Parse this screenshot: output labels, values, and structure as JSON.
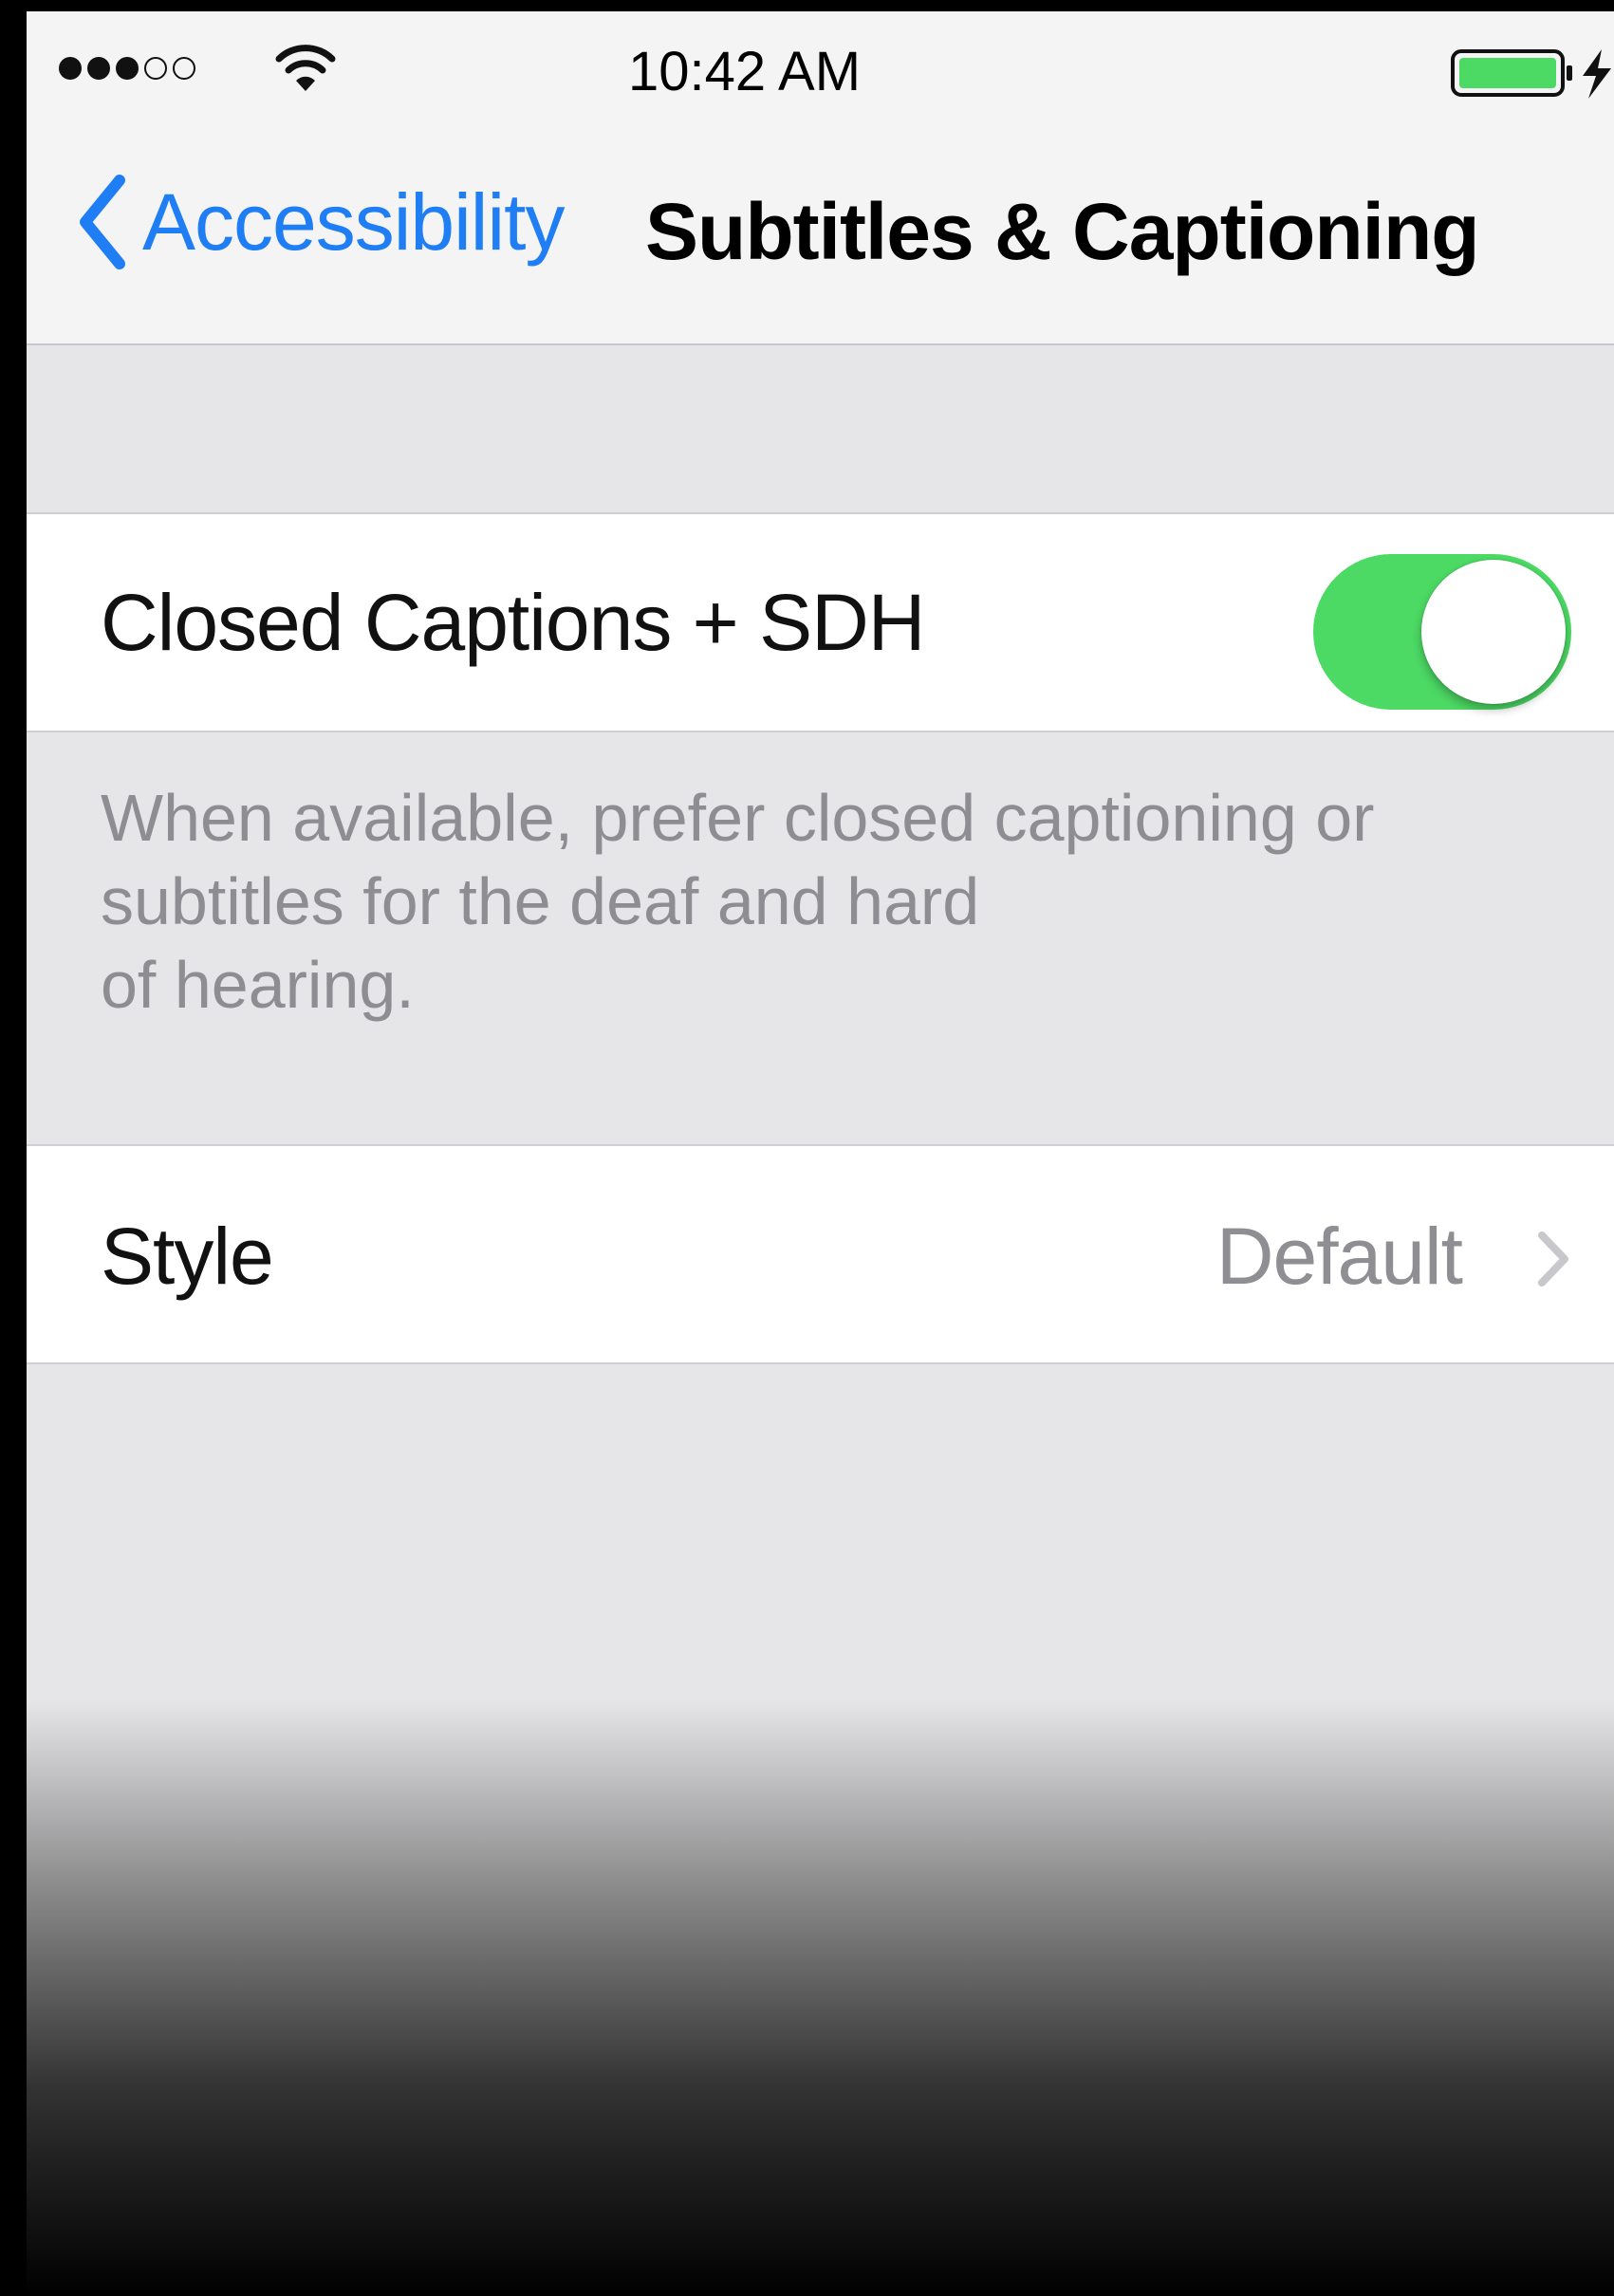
{
  "status_bar": {
    "time": "10:42 AM",
    "signal_bars_filled": 3,
    "signal_bars_total": 5,
    "battery_level": 1.0,
    "charging": true
  },
  "nav": {
    "back_label": "Accessibility",
    "title": "Subtitles & Captioning"
  },
  "settings": {
    "captions": {
      "label": "Closed Captions + SDH",
      "enabled": true,
      "footer": "When available, prefer closed captioning or\nsubtitles for the deaf and hard\nof hearing."
    },
    "style": {
      "label": "Style",
      "value": "Default"
    }
  },
  "colors": {
    "accent": "#1f7ef4",
    "toggle_on": "#4cd964",
    "background": "#e6e6e8"
  }
}
